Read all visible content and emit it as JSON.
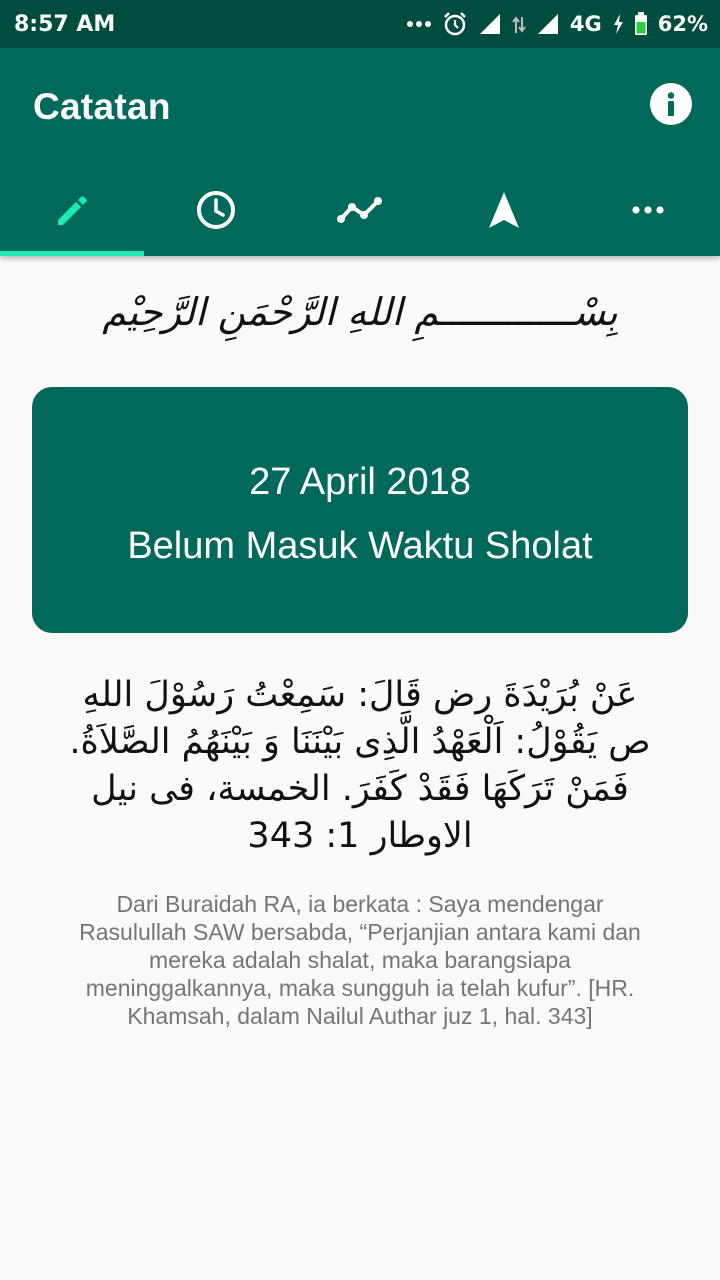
{
  "status_bar": {
    "time": "8:57 AM",
    "network": "4G",
    "battery": "62%",
    "icons": [
      "more-notifications-icon",
      "alarm-icon",
      "signal-icon",
      "data-arrows-icon",
      "signal-icon",
      "charging-icon",
      "battery-icon"
    ]
  },
  "app_bar": {
    "title": "Catatan",
    "info_icon": "info-icon"
  },
  "tabs": [
    {
      "icon": "pencil-icon",
      "selected": true
    },
    {
      "icon": "clock-icon",
      "selected": false
    },
    {
      "icon": "trend-line-icon",
      "selected": false
    },
    {
      "icon": "navigation-arrow-icon",
      "selected": false
    },
    {
      "icon": "more-horizontal-icon",
      "selected": false
    }
  ],
  "bismillah": "بِسْــــــــــــمِ اللهِ الرَّحْمَنِ الرَّحِيْم",
  "card": {
    "date": "27 April 2018",
    "status": "Belum Masuk Waktu Sholat"
  },
  "hadith": {
    "arabic": "عَنْ بُرَيْدَةَ رض قَالَ: سَمِعْتُ رَسُوْلَ اللهِ ص يَقُوْلُ: اَلْعَهْدُ الَّذِى بَيْنَنَا وَ بَيْنَهُمُ الصَّلاَةُ. فَمَنْ تَرَكَهَا فَقَدْ كَفَرَ. الخمسة، فى نيل الاوطار 1: 343",
    "translation": "Dari Buraidah RA, ia berkata : Saya mendengar Rasulullah SAW bersabda, “Perjanjian antara kami dan mereka adalah shalat, maka barangsiapa meninggalkannya, maka sungguh ia telah kufur”. [HR. Khamsah, dalam Nailul Authar juz 1, hal. 343]"
  },
  "colors": {
    "status_bar": "#004d40",
    "primary": "#00695c",
    "tab_indicator": "#1de9b6",
    "selected_tab_icon": "#1de9b6",
    "background": "#fafafa",
    "translation_text": "#757575"
  }
}
